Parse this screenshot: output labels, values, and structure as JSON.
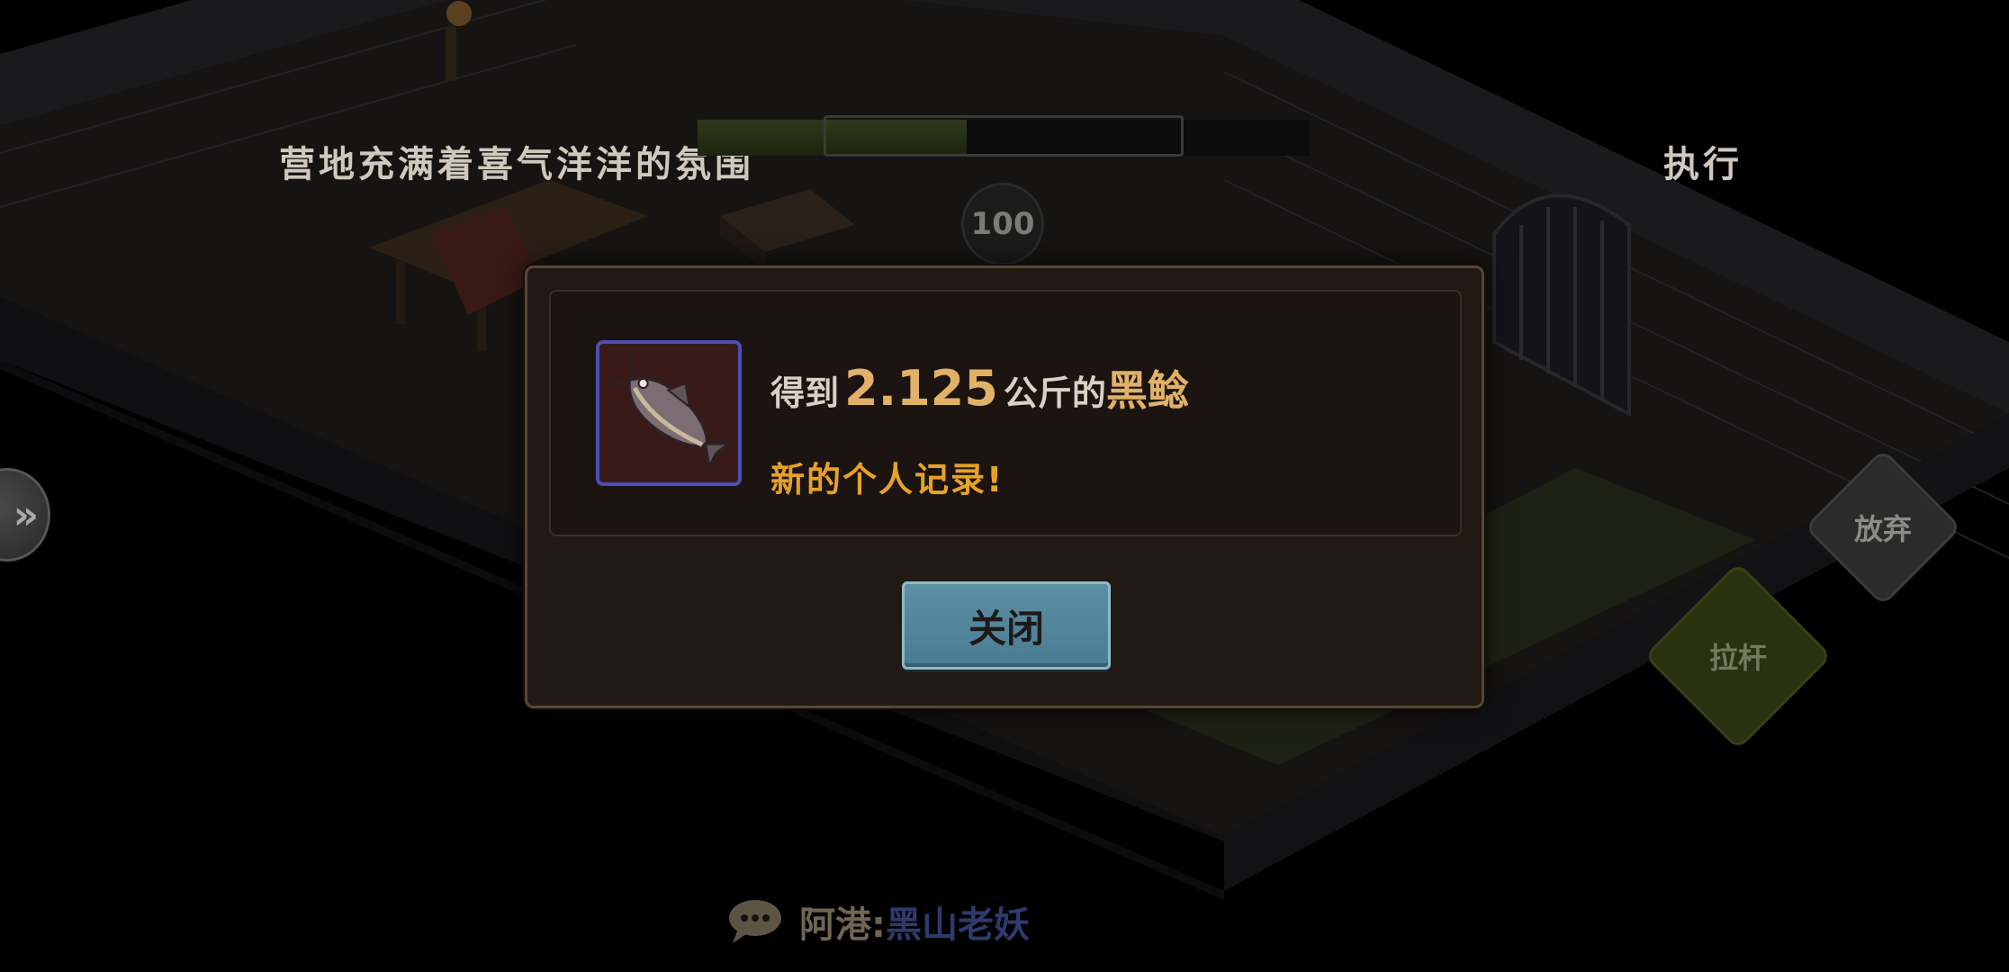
{
  "hud": {
    "status_text": "营地充满着喜气洋洋的氛围",
    "execute_label": "执行",
    "progress_fraction": 0.44,
    "count_badge": "100",
    "side_toggle_glyph": "»"
  },
  "actions": {
    "abandon_label": "放弃",
    "pull_label": "拉杆"
  },
  "chat": {
    "icon": "chat-bubble-icon",
    "name": "阿港:",
    "message": "黑山老妖"
  },
  "modal": {
    "item_icon": "fish-icon",
    "catch_prefix": "得到",
    "weight": "2.125",
    "weight_unit": "公斤的",
    "fish_name": "黑鲶",
    "record_text": "新的个人记录!",
    "close_label": "关闭"
  },
  "colors": {
    "modal_bg": "#201914",
    "highlight_gold": "#e0b167",
    "record_orange": "#e5a227",
    "close_button": "#5c8fa6",
    "item_border": "#4a4fb5"
  }
}
